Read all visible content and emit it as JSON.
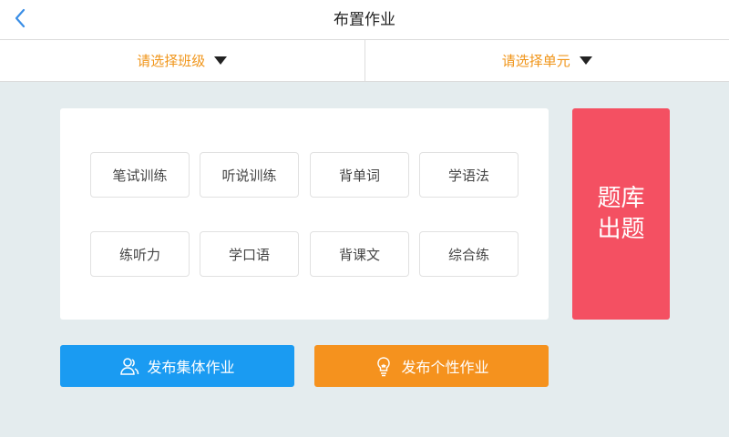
{
  "header": {
    "title": "布置作业",
    "back_icon": "chevron-left-icon"
  },
  "filters": [
    {
      "label": "请选择班级",
      "icon": "caret-down-icon"
    },
    {
      "label": "请选择单元",
      "icon": "caret-down-icon"
    }
  ],
  "practice_types": [
    "笔试训练",
    "听说训练",
    "背单词",
    "学语法",
    "练听力",
    "学口语",
    "背课文",
    "综合练"
  ],
  "question_bank": {
    "line1": "题库",
    "line2": "出题"
  },
  "actions": {
    "group": {
      "label": "发布集体作业",
      "icon": "users-icon"
    },
    "personal": {
      "label": "发布个性作业",
      "icon": "lightbulb-icon"
    }
  },
  "colors": {
    "accent_orange_text": "#f0951a",
    "back_arrow_blue": "#3a8ee6",
    "bank_red": "#f45062",
    "group_blue": "#1a9bf2",
    "personal_orange": "#f5921e",
    "background": "#e4ecee"
  }
}
